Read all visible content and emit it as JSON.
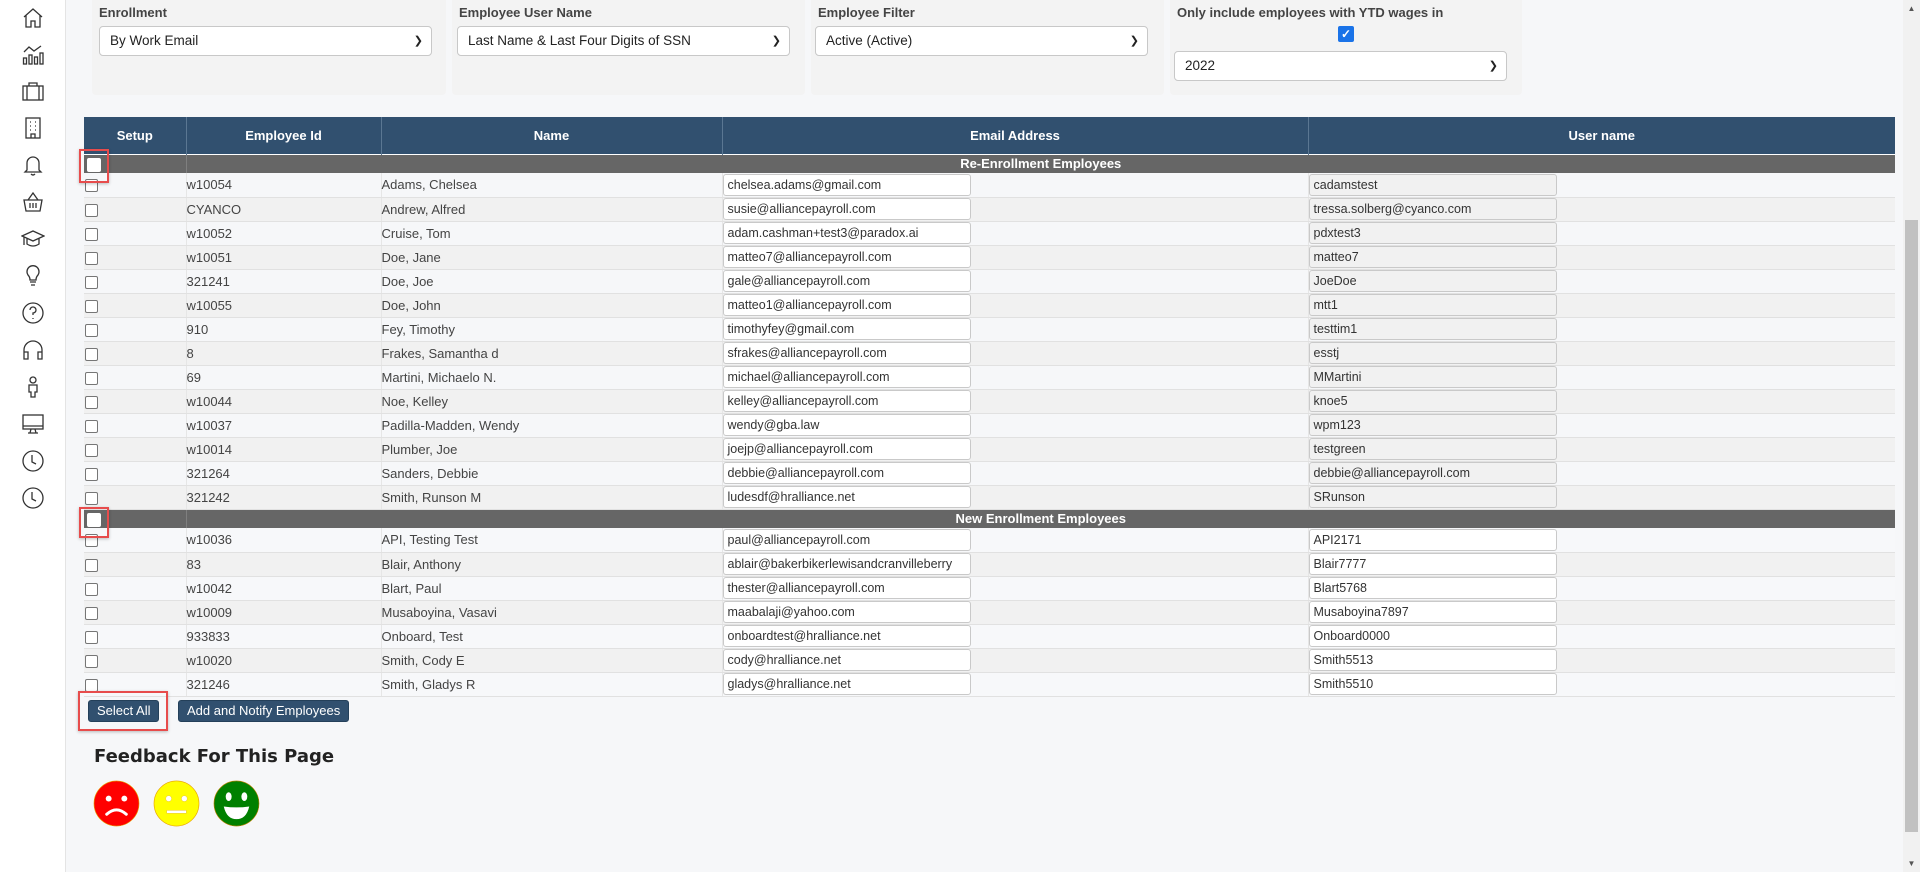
{
  "sidebar": {
    "icons": [
      "home-icon",
      "analytics-icon",
      "briefcase-icon",
      "building-icon",
      "bell-icon",
      "basket-icon",
      "graduation-cap-icon",
      "lightbulb-icon",
      "help-icon",
      "headset-icon",
      "person-icon",
      "monitor-icon",
      "clock-icon",
      "clock-icon"
    ]
  },
  "filters": {
    "enrollment": {
      "label": "Enrollment",
      "value": "By Work Email"
    },
    "user_name": {
      "label": "Employee User Name",
      "value": "Last Name & Last Four Digits of SSN"
    },
    "employee_filter": {
      "label": "Employee Filter",
      "value": "Active (Active)"
    },
    "ytd": {
      "label": "Only include employees with YTD wages in",
      "checked": true,
      "check_glyph": "✓",
      "year": "2022"
    }
  },
  "table": {
    "headers": [
      "Setup",
      "Employee Id",
      "Name",
      "Email Address",
      "User name"
    ],
    "groups": [
      {
        "title": "Re-Enrollment Employees",
        "rows": [
          {
            "id": "w10054",
            "name": "Adams, Chelsea",
            "email": "chelsea.adams@gmail.com",
            "username": "cadamstest"
          },
          {
            "id": "CYANCO",
            "name": "Andrew, Alfred",
            "email": "susie@alliancepayroll.com",
            "username": "tressa.solberg@cyanco.com"
          },
          {
            "id": "w10052",
            "name": "Cruise, Tom",
            "email": "adam.cashman+test3@paradox.ai",
            "username": "pdxtest3"
          },
          {
            "id": "w10051",
            "name": "Doe, Jane",
            "email": "matteo7@alliancepayroll.com",
            "username": "matteo7"
          },
          {
            "id": "321241",
            "name": "Doe, Joe",
            "email": "gale@alliancepayroll.com",
            "username": "JoeDoe"
          },
          {
            "id": "w10055",
            "name": "Doe, John",
            "email": "matteo1@alliancepayroll.com",
            "username": "mtt1"
          },
          {
            "id": "910",
            "name": "Fey, Timothy",
            "email": "timothyfey@gmail.com",
            "username": "testtim1"
          },
          {
            "id": "8",
            "name": "Frakes, Samantha d",
            "email": "sfrakes@alliancepayroll.com",
            "username": "esstj"
          },
          {
            "id": "69",
            "name": "Martini, Michaelo N.",
            "email": "michael@alliancepayroll.com",
            "username": "MMartini"
          },
          {
            "id": "w10044",
            "name": "Noe, Kelley",
            "email": "kelley@alliancepayroll.com",
            "username": "knoe5"
          },
          {
            "id": "w10037",
            "name": "Padilla-Madden, Wendy",
            "email": "wendy@gba.law",
            "username": "wpm123"
          },
          {
            "id": "w10014",
            "name": "Plumber, Joe",
            "email": "joejp@alliancepayroll.com",
            "username": "testgreen"
          },
          {
            "id": "321264",
            "name": "Sanders, Debbie",
            "email": "debbie@alliancepayroll.com",
            "username": "debbie@alliancepayroll.com"
          },
          {
            "id": "321242",
            "name": "Smith, Runson M",
            "email": "ludesdf@hralliance.net",
            "username": "SRunson"
          }
        ]
      },
      {
        "title": "New Enrollment Employees",
        "rows": [
          {
            "id": "w10036",
            "name": "API, Testing Test",
            "email": "paul@alliancepayroll.com",
            "username": "API2171"
          },
          {
            "id": "83",
            "name": "Blair, Anthony",
            "email": "ablair@bakerbikerlewisandcranvilleberry",
            "username": "Blair7777"
          },
          {
            "id": "w10042",
            "name": "Blart, Paul",
            "email": "thester@alliancepayroll.com",
            "username": "Blart5768"
          },
          {
            "id": "w10009",
            "name": "Musaboyina, Vasavi",
            "email": "maabalaji@yahoo.com",
            "username": "Musaboyina7897"
          },
          {
            "id": "933833",
            "name": "Onboard, Test",
            "email": "onboardtest@hralliance.net",
            "username": "Onboard0000"
          },
          {
            "id": "w10020",
            "name": "Smith, Cody E",
            "email": "cody@hralliance.net",
            "username": "Smith5513"
          },
          {
            "id": "321246",
            "name": "Smith, Gladys R",
            "email": "gladys@hralliance.net",
            "username": "Smith5510"
          }
        ]
      }
    ]
  },
  "buttons": {
    "select_all": "Select All",
    "add_notify": "Add and Notify Employees"
  },
  "feedback": {
    "title": "Feedback For This Page",
    "faces": [
      {
        "name": "sad-face-icon",
        "color": "#ff0000"
      },
      {
        "name": "neutral-face-icon",
        "color": "#ffff00"
      },
      {
        "name": "happy-face-icon",
        "color": "#008000"
      }
    ]
  },
  "colors": {
    "header": "#31506f",
    "group": "#666666",
    "highlight": "#e74c4c"
  }
}
